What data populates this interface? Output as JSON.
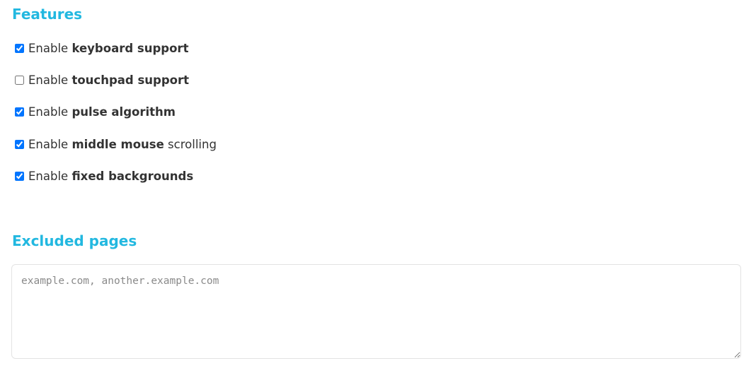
{
  "features": {
    "title": "Features",
    "options": [
      {
        "prefix": "Enable ",
        "bold": "keyboard support",
        "suffix": "",
        "checked": true
      },
      {
        "prefix": "Enable ",
        "bold": "touchpad support",
        "suffix": "",
        "checked": false
      },
      {
        "prefix": "Enable ",
        "bold": "pulse algorithm",
        "suffix": "",
        "checked": true
      },
      {
        "prefix": "Enable ",
        "bold": "middle mouse",
        "suffix": " scrolling",
        "checked": true
      },
      {
        "prefix": "Enable ",
        "bold": "fixed backgrounds",
        "suffix": "",
        "checked": true
      }
    ]
  },
  "excluded": {
    "title": "Excluded pages",
    "value": "",
    "placeholder": "example.com, another.example.com"
  },
  "colors": {
    "heading": "#22b8e0",
    "text": "#333333"
  }
}
